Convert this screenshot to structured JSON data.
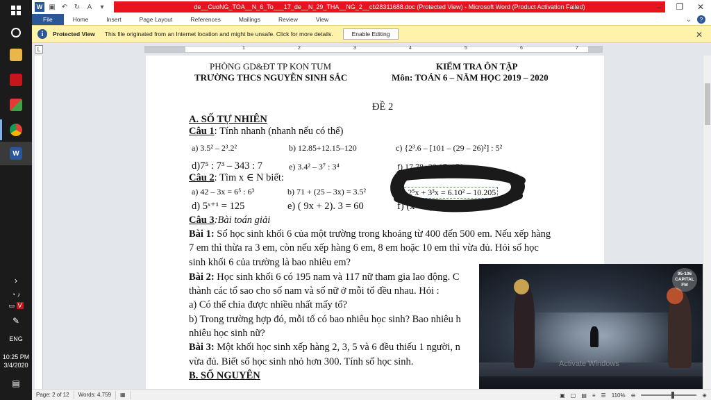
{
  "window": {
    "title": "de__CuoNG_TOA__N_6_To___17_de__N_29_THA__NG_2__cb28311688.doc (Protected View) - Microsoft Word (Product Activation Failed)",
    "ribbon_tabs": [
      "File",
      "Home",
      "Insert",
      "Page Layout",
      "References",
      "Mailings",
      "Review",
      "View"
    ]
  },
  "protected_view": {
    "title": "Protected View",
    "message": "This file originated from an Internet location and might be unsafe. Click for more details.",
    "button": "Enable Editing"
  },
  "ruler": {
    "numbers": [
      "1",
      "2",
      "3",
      "4",
      "5",
      "6",
      "7"
    ]
  },
  "document": {
    "header_left_1": "PHÒNG GD&ĐT TP KON TUM",
    "header_left_2": "TRƯỜNG THCS NGUYỄN SINH SẮC",
    "header_right_1": "KIỂM TRA ÔN TẬP",
    "header_right_2": "Môn:  TOÁN 6 – NĂM HỌC 2019 – 2020",
    "de": "ĐỀ 2",
    "section_a": "A. SỐ TỰ NHIÊN",
    "cau1_label": "Câu 1",
    "cau1_text": ": Tính nhanh (nhanh nếu có thể)",
    "c1a": "a)  3.5² – 2³.2²",
    "c1b": "b)  12.85+12.15–120",
    "c1c": "c) {2³.6 – [101 – (29 – 26)²] : 5²",
    "c1d": "d)7⁵ : 7³ – 343 : 7",
    "c1e": "e)  3.4² – 3⁷ : 3⁴",
    "c1f": "f) 17.78+22.17–170",
    "cau2_label": "Câu 2",
    "cau2_text": ": Tìm x ∈ N  biết:",
    "c2a": "a) 42 – 3x = 6⁵ : 6³",
    "c2b": "b) 71 + (25 – 3x) = 3.5²",
    "c2c": "c) 2⁵x + 3³x = 6.10² – 10.205",
    "c2d": "d)  5ˣ⁺¹ = 125",
    "c2e": "e) ( 9x + 2). 3 = 60",
    "c2f": "f)  (x – 6)² = 9",
    "cau3_label": "Câu 3",
    "cau3_text": ":Bài toán giải",
    "bai1_label": "Bài 1:",
    "bai1_l1": " Số học sinh khối 6 của một trường trong khoảng từ 400 đến 500 em. Nếu xếp hàng",
    "bai1_l2": "7 em thì thừa ra 3 em, còn nếu xếp hàng 6 em, 8 em hoặc 10 em thì vừa đủ. Hỏi số học",
    "bai1_l3": "sinh khối 6 của trường là bao nhiêu em?",
    "bai2_label": " Bài 2:",
    "bai2_l1": " Học sinh khối 6 có 195 nam và 117 nữ tham gia lao động. C",
    "bai2_l2": "thành các tổ sao cho số nam và số nữ ở mỗi tổ đều nhau. Hỏi :",
    "bai2_l3": "a) Có thể chia được nhiều nhất mấy tổ?",
    "bai2_l4": "b) Trong trường hợp đó, mỗi tổ có bao nhiêu học sinh? Bao nhiêu h",
    "bai2_l5": "nhiêu học sinh nữ?",
    "bai3_label": "Bài 3:",
    "bai3_l1": " Một khối học sinh xếp hàng 2, 3, 5 và 6 đều thiếu 1 người, n",
    "bai3_l2": "vừa đủ. Biết số học sinh nhỏ hơn 300. Tính số học sinh.",
    "section_b": "B. SỐ NGUYÊN"
  },
  "video": {
    "logo_line1": "95-106",
    "logo_line2": "CAPITAL",
    "logo_line3": "FM",
    "watermark": "Activate Windows"
  },
  "statusbar": {
    "page": "Page: 2 of 12",
    "words": "Words: 4,759",
    "zoom": "110%"
  },
  "taskbar": {
    "lang": "ENG",
    "time": "10:25 PM",
    "date": "3/4/2020"
  }
}
